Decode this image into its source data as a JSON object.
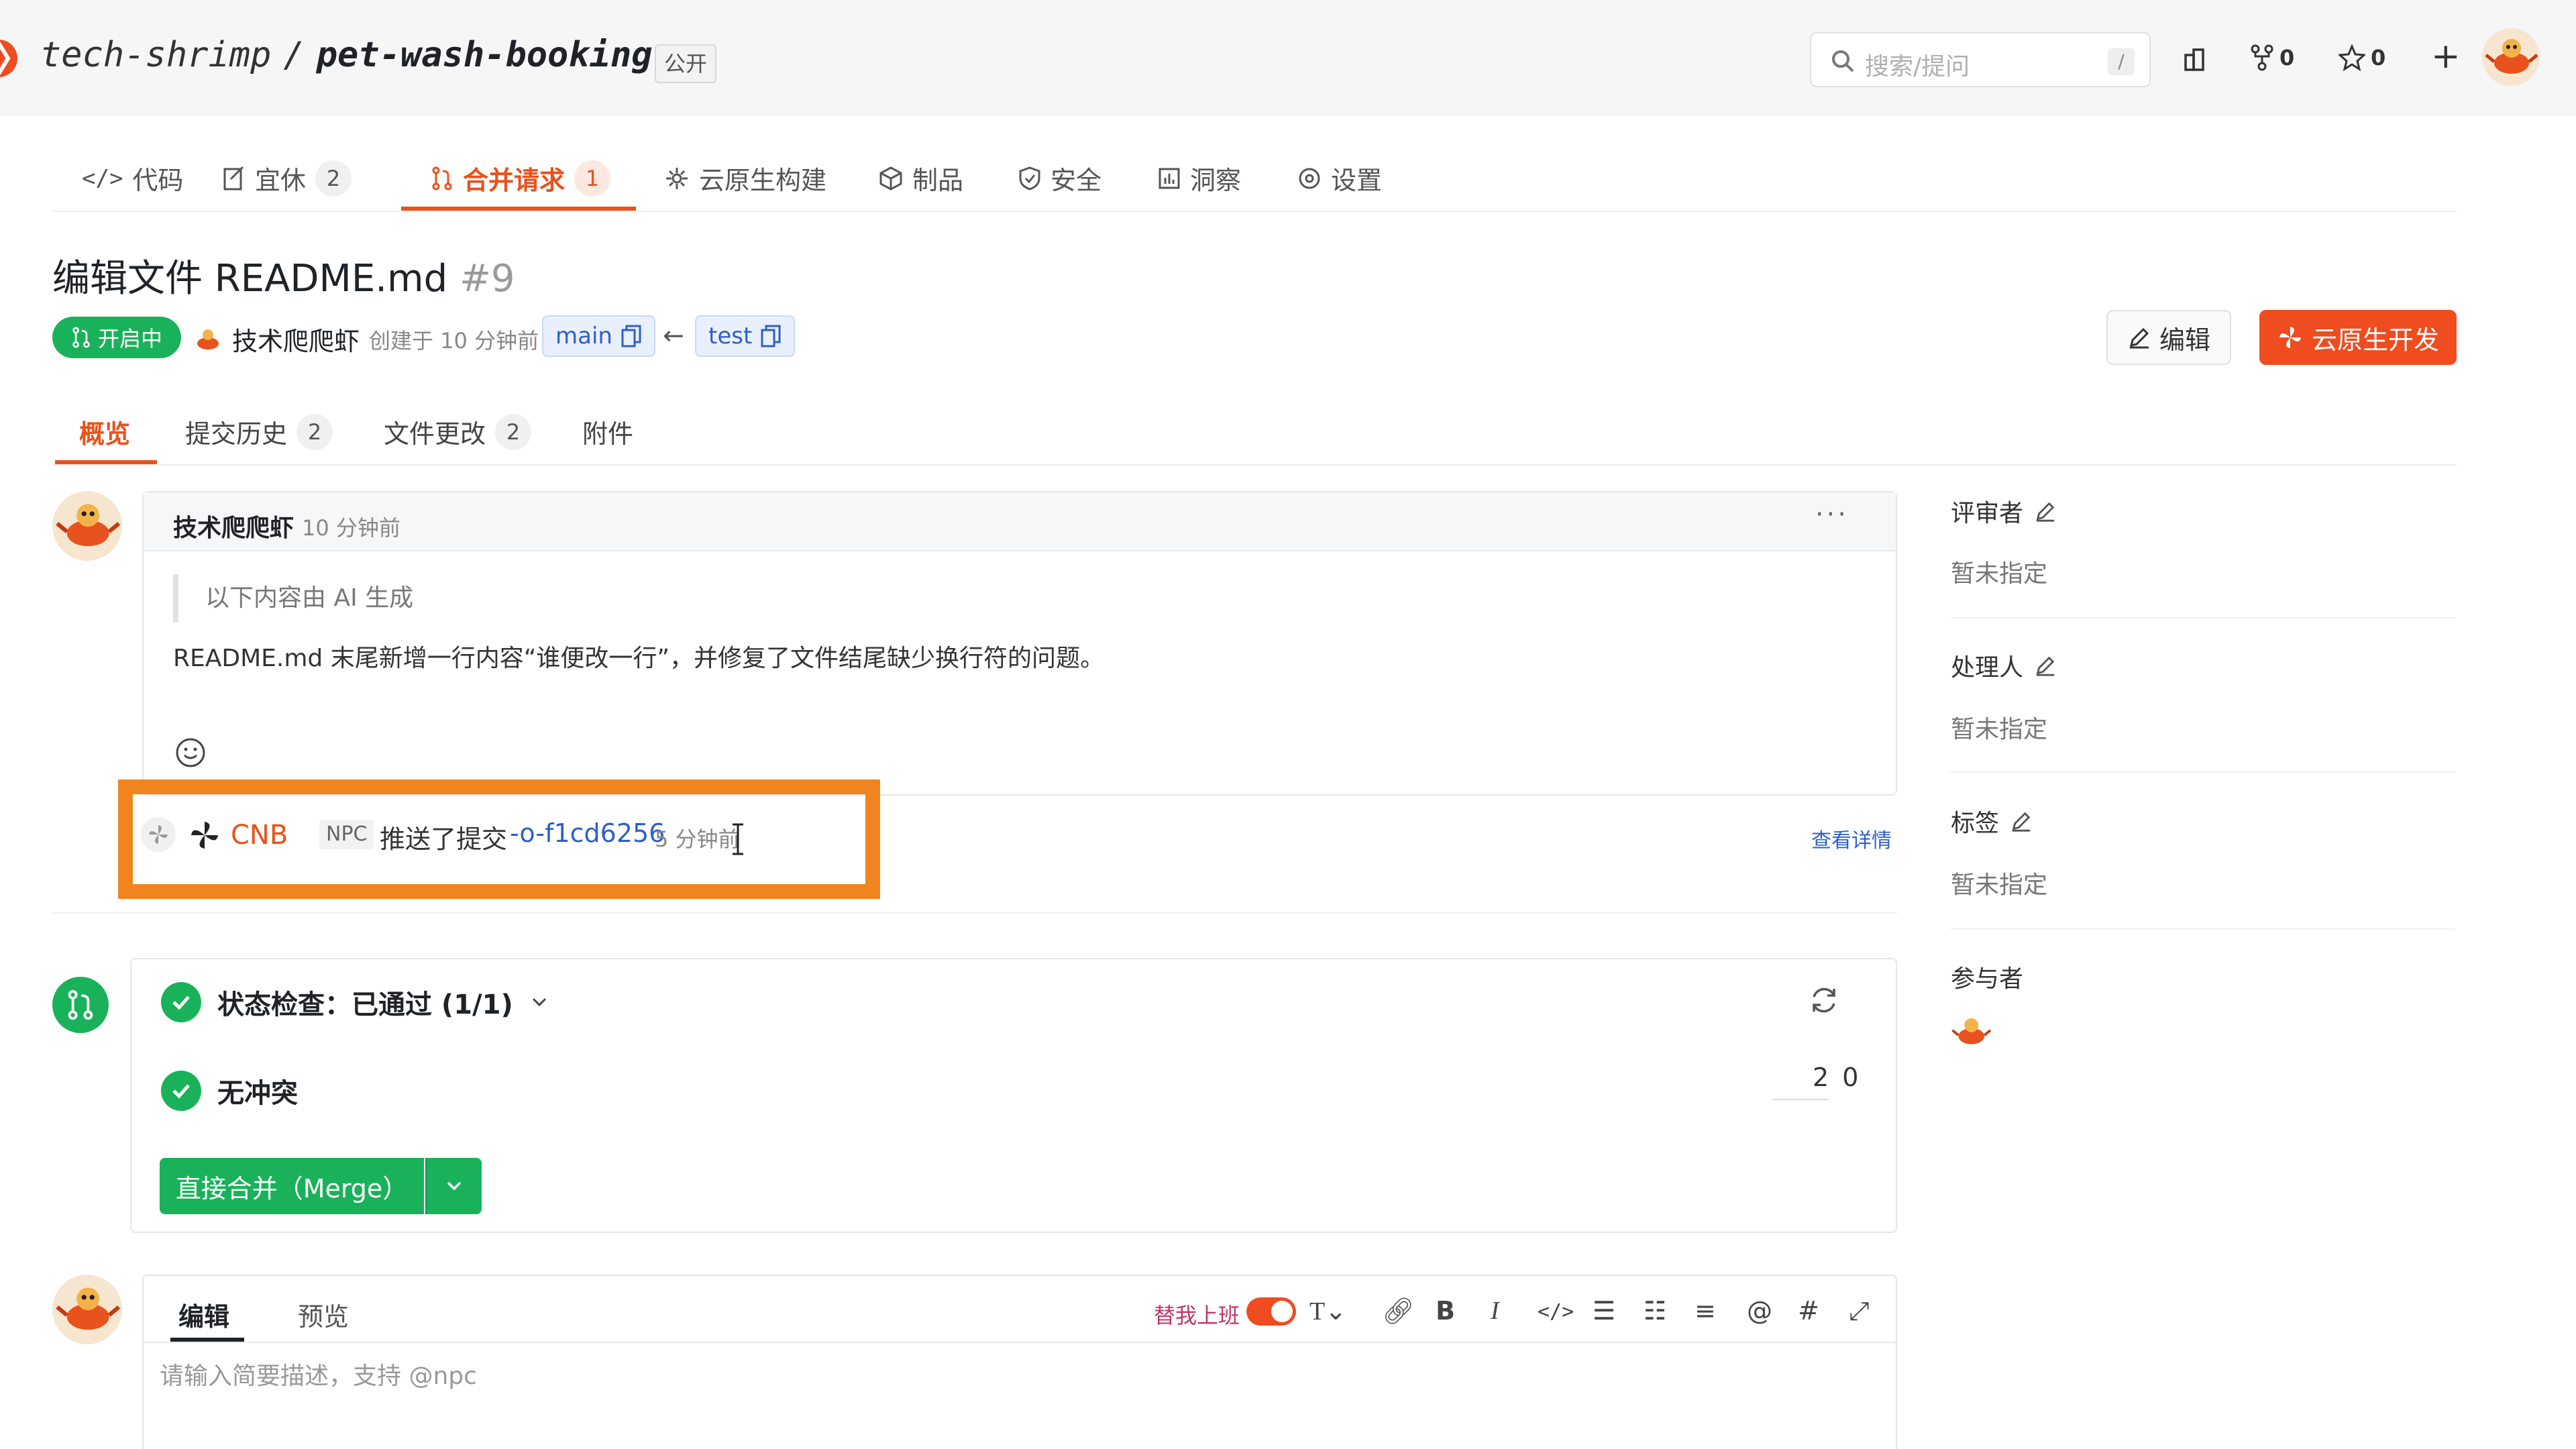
{
  "header": {
    "owner": "tech-shrimp",
    "separator": "/",
    "repo": "pet-wash-booking",
    "visibility": "公开",
    "search_placeholder": "搜索/提问",
    "search_shortcut": "/",
    "fork_count": "0",
    "star_count": "0",
    "new_symbol": "+"
  },
  "repo_tabs": [
    {
      "label": "代码",
      "icon": "code-icon",
      "count": ""
    },
    {
      "label": "宜休",
      "icon": "issue-icon",
      "count": "2"
    },
    {
      "label": "合并请求",
      "icon": "pull-request-icon",
      "count": "1"
    },
    {
      "label": "云原生构建",
      "icon": "build-icon",
      "count": ""
    },
    {
      "label": "制品",
      "icon": "package-icon",
      "count": ""
    },
    {
      "label": "安全",
      "icon": "shield-icon",
      "count": ""
    },
    {
      "label": "洞察",
      "icon": "chart-icon",
      "count": ""
    },
    {
      "label": "设置",
      "icon": "gear-icon",
      "count": ""
    }
  ],
  "pr": {
    "title": "编辑文件 README.md",
    "number": "#9",
    "status": "开启中",
    "author": "技术爬爬虾",
    "created": "创建于 10 分钟前",
    "base_branch": "main",
    "head_branch": "test",
    "arrow": "←",
    "edit_label": "编辑",
    "cloud_dev_label": "云原生开发"
  },
  "pr_tabs": [
    {
      "label": "概览",
      "count": ""
    },
    {
      "label": "提交历史",
      "count": "2"
    },
    {
      "label": "文件更改",
      "count": "2"
    },
    {
      "label": "附件",
      "count": ""
    }
  ],
  "comment": {
    "author": "技术爬爬虾",
    "time": "10 分钟前",
    "more": "···",
    "quote": "以下内容由 AI 生成",
    "body": "README.md 末尾新增一行内容“谁便改一行”，并修复了文件结尾缺少换行符的问题。"
  },
  "event": {
    "actor": "CNB",
    "tag": "NPC",
    "action": "推送了提交",
    "commit": "-o-f1cd6256",
    "time": "5 分钟前",
    "detail": "查看详情"
  },
  "checks": {
    "status_title": "状态检查：已通过 (1/1)",
    "conflict_title": "无冲突",
    "count_a": "2",
    "count_b": "0",
    "merge_label": "直接合并（Merge）"
  },
  "editor": {
    "tab_edit": "编辑",
    "tab_preview": "预览",
    "toggle_label": "替我上班",
    "placeholder": "请输入简要描述，支持 @npc"
  },
  "sidebar": {
    "reviewers_label": "评审者",
    "reviewers_value": "暂未指定",
    "assignees_label": "处理人",
    "assignees_value": "暂未指定",
    "labels_label": "标签",
    "labels_value": "暂未指定",
    "participants_label": "参与者"
  },
  "colors": {
    "accent": "#e8521c",
    "success": "#19b25a",
    "link": "#2f5fc8",
    "highlight_box": "#f0841e"
  }
}
